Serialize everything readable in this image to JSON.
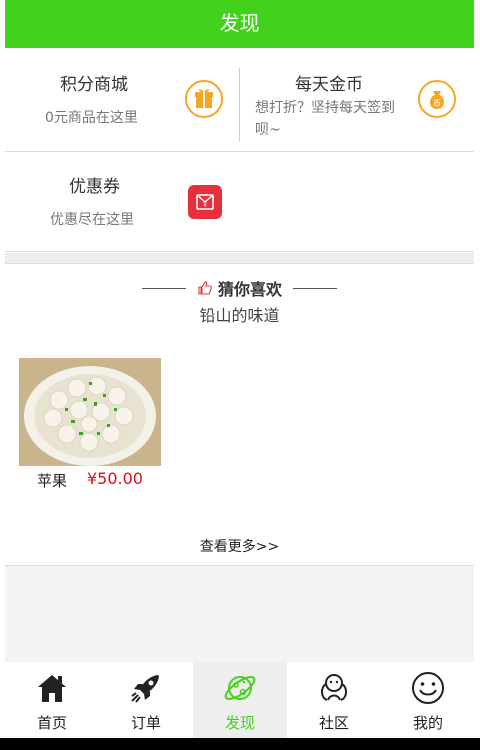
{
  "header": {
    "title": "发现"
  },
  "cards": {
    "points_mall": {
      "title": "积分商城",
      "subtitle": "0元商品在这里",
      "icon": "gift-icon"
    },
    "daily_coins": {
      "title": "每天金币",
      "subtitle": "想打折？坚持每天签到呗~",
      "icon": "coin-bag-icon"
    },
    "coupons": {
      "title": "优惠券",
      "subtitle": "优惠尽在这里",
      "icon": "red-envelope-icon"
    }
  },
  "recommend": {
    "title": "猜你喜欢",
    "subtitle": "铅山的味道",
    "icon": "thumbs-up-icon",
    "products": [
      {
        "name": "苹果",
        "price": "¥50.00"
      }
    ],
    "more_label": "查看更多>>"
  },
  "tabbar": {
    "active": "发现",
    "active_color": "#43d21b",
    "items": [
      {
        "label": "首页",
        "icon": "home-icon"
      },
      {
        "label": "订单",
        "icon": "rocket-icon"
      },
      {
        "label": "发现",
        "icon": "planet-icon"
      },
      {
        "label": "社区",
        "icon": "community-icon"
      },
      {
        "label": "我的",
        "icon": "smiley-icon"
      }
    ]
  },
  "colors": {
    "brand_green": "#43d21b",
    "price_red": "#d4121a",
    "icon_orange": "#f5a623"
  }
}
